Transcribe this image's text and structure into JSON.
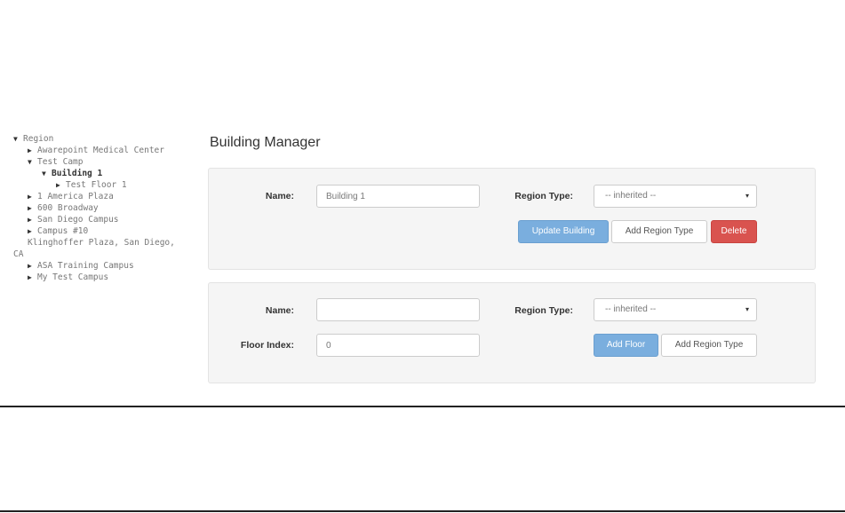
{
  "tree": {
    "root": "Region",
    "items": [
      {
        "label": "Awarepoint Medical Center",
        "level": 1,
        "arrow": "right"
      },
      {
        "label": "Test Camp",
        "level": 1,
        "arrow": "down"
      },
      {
        "label": "Building 1",
        "level": 2,
        "arrow": "down",
        "selected": true
      },
      {
        "label": "Test Floor 1",
        "level": 3,
        "arrow": "right"
      },
      {
        "label": "1 America Plaza",
        "level": 1,
        "arrow": "right"
      },
      {
        "label": "600 Broadway",
        "level": 1,
        "arrow": "right"
      },
      {
        "label": "San Diego Campus",
        "level": 1,
        "arrow": "right"
      },
      {
        "label": "Campus #10",
        "level": 1,
        "arrow": "right"
      },
      {
        "label": "Klinghoffer Plaza, San Diego, CA",
        "level": 1,
        "arrow": "none"
      },
      {
        "label": "ASA Training Campus",
        "level": 1,
        "arrow": "right"
      },
      {
        "label": "My Test Campus",
        "level": 1,
        "arrow": "right"
      }
    ]
  },
  "page_title": "Building Manager",
  "building_form": {
    "name_label": "Name:",
    "name_value": "Building 1",
    "region_type_label": "Region Type:",
    "region_type_value": "-- inherited --",
    "update_button": "Update Building",
    "add_region_type_button": "Add Region Type",
    "delete_button": "Delete"
  },
  "floor_form": {
    "name_label": "Name:",
    "name_value": "",
    "region_type_label": "Region Type:",
    "region_type_value": "-- inherited --",
    "floor_index_label": "Floor Index:",
    "floor_index_value": "0",
    "add_floor_button": "Add Floor",
    "add_region_type_button": "Add Region Type"
  },
  "colors": {
    "primary": "#7aaede",
    "danger": "#d9534f",
    "panel_bg": "#f5f5f5"
  }
}
